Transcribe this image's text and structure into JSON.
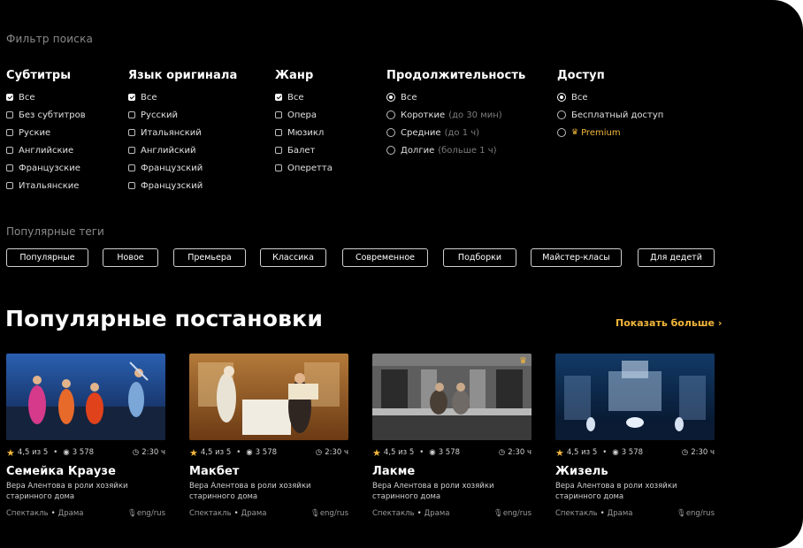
{
  "filter": {
    "title": "Фильтр поиска",
    "columns": [
      {
        "heading": "Субтитры",
        "type": "checkbox",
        "options": [
          {
            "label": "Все",
            "checked": true
          },
          {
            "label": "Без субтитров",
            "checked": false
          },
          {
            "label": "Руские",
            "checked": false
          },
          {
            "label": "Английские",
            "checked": false
          },
          {
            "label": "Французские",
            "checked": false
          },
          {
            "label": "Итальянские",
            "checked": false
          }
        ]
      },
      {
        "heading": "Язык оригинала",
        "type": "checkbox",
        "options": [
          {
            "label": "Все",
            "checked": true
          },
          {
            "label": "Русский",
            "checked": false
          },
          {
            "label": "Итальянский",
            "checked": false
          },
          {
            "label": "Английский",
            "checked": false
          },
          {
            "label": "Французский",
            "checked": false
          },
          {
            "label": "Французский",
            "checked": false
          }
        ]
      },
      {
        "heading": "Жанр",
        "type": "checkbox",
        "options": [
          {
            "label": "Все",
            "checked": true
          },
          {
            "label": "Опера",
            "checked": false
          },
          {
            "label": "Мюзикл",
            "checked": false
          },
          {
            "label": "Балет",
            "checked": false
          },
          {
            "label": "Оперетта",
            "checked": false
          }
        ]
      },
      {
        "heading": "Продолжительность",
        "type": "radio",
        "options": [
          {
            "label": "Все",
            "checked": true,
            "hint": ""
          },
          {
            "label": "Короткие",
            "checked": false,
            "hint": "(до 30 мин)"
          },
          {
            "label": "Средние",
            "checked": false,
            "hint": "(до 1 ч)"
          },
          {
            "label": "Долгие",
            "checked": false,
            "hint": "(больше 1 ч)"
          }
        ]
      },
      {
        "heading": "Доступ",
        "type": "radio",
        "options": [
          {
            "label": "Все",
            "checked": true
          },
          {
            "label": "Бесплатный доступ",
            "checked": false
          },
          {
            "label": "Premium",
            "checked": false,
            "premium": true
          }
        ]
      }
    ]
  },
  "tags": {
    "title": "Популярные теги",
    "items": [
      "Популярные",
      "Новое",
      "Премьера",
      "Классика",
      "Современное",
      "Подборки",
      "Майстер-класы",
      "Для дедетй"
    ]
  },
  "popular": {
    "title": "Популярные постановки",
    "more_label": "Показать больше",
    "cards": [
      {
        "title": "Семейка Краузе",
        "rating": "4,5 из 5",
        "views": "3 578",
        "duration": "2:30 ч",
        "desc": "Вера Алентова в роли хозяйки старинного дома",
        "type": "Спектакль",
        "genre": "Драма",
        "lang": "eng/rus",
        "premium": false
      },
      {
        "title": "Макбет",
        "rating": "4,5 из 5",
        "views": "3 578",
        "duration": "2:30 ч",
        "desc": "Вера Алентова в роли хозяйки старинного дома",
        "type": "Спектакль",
        "genre": "Драма",
        "lang": "eng/rus",
        "premium": false
      },
      {
        "title": "Лакме",
        "rating": "4,5 из 5",
        "views": "3 578",
        "duration": "2:30 ч",
        "desc": "Вера Алентова в роли хозяйки старинного дома",
        "type": "Спектакль",
        "genre": "Драма",
        "lang": "eng/rus",
        "premium": true
      },
      {
        "title": "Жизель",
        "rating": "4,5 из 5",
        "views": "3 578",
        "duration": "2:30 ч",
        "desc": "Вера Алентова в роли хозяйки старинного дома",
        "type": "Спектакль",
        "genre": "Драма",
        "lang": "eng/rus",
        "premium": false
      }
    ]
  },
  "colors": {
    "background": "#000000",
    "accent": "#f2b73a",
    "muted": "#8a8a8a"
  }
}
